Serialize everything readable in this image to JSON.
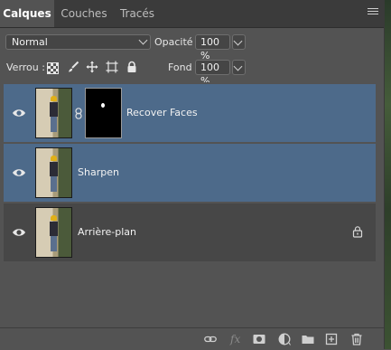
{
  "tabs": [
    {
      "label": "Calques",
      "active": true
    },
    {
      "label": "Couches",
      "active": false
    },
    {
      "label": "Tracés",
      "active": false
    }
  ],
  "toolbar": {
    "blend_mode": "Normal",
    "opacity_label": "Opacité :",
    "opacity_value": "100 %",
    "lock_label": "Verrou :",
    "fill_label": "Fond :",
    "fill_value": "100 %"
  },
  "layers": [
    {
      "name": "Recover Faces",
      "selected": true,
      "has_mask": true,
      "locked": false,
      "visible": true
    },
    {
      "name": "Sharpen",
      "selected": true,
      "has_mask": false,
      "locked": false,
      "visible": true
    },
    {
      "name": "Arrière-plan",
      "selected": false,
      "has_mask": false,
      "locked": true,
      "visible": true
    }
  ],
  "footer_icons": [
    "link-icon",
    "fx-icon",
    "add-mask-icon",
    "adjustment-layer-icon",
    "group-folder-icon",
    "new-layer-icon",
    "trash-icon"
  ],
  "footer": {
    "fx_text": "fx"
  },
  "colors": {
    "selected_row": "#4d6a8a",
    "panel_bg": "#535353",
    "tab_bar": "#3b3b3b"
  }
}
